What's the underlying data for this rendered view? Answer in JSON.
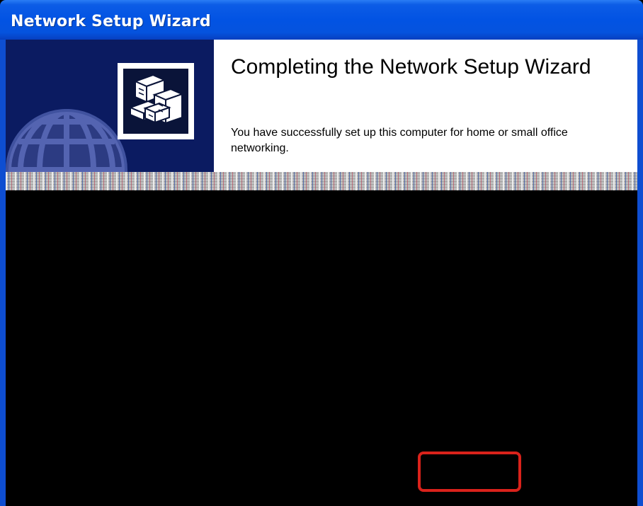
{
  "window": {
    "title": "Network Setup Wizard"
  },
  "wizard": {
    "heading": "Completing the Network Setup Wizard",
    "message": "You have successfully set up this computer for home or small office networking."
  },
  "icons": {
    "banner_globe": "globe-icon",
    "banner_network": "network-computers-icon"
  },
  "colors": {
    "titlebar": "#0253e3",
    "banner": "#0b1b61",
    "highlight": "#d9221b",
    "redacted_area": "#000000"
  }
}
